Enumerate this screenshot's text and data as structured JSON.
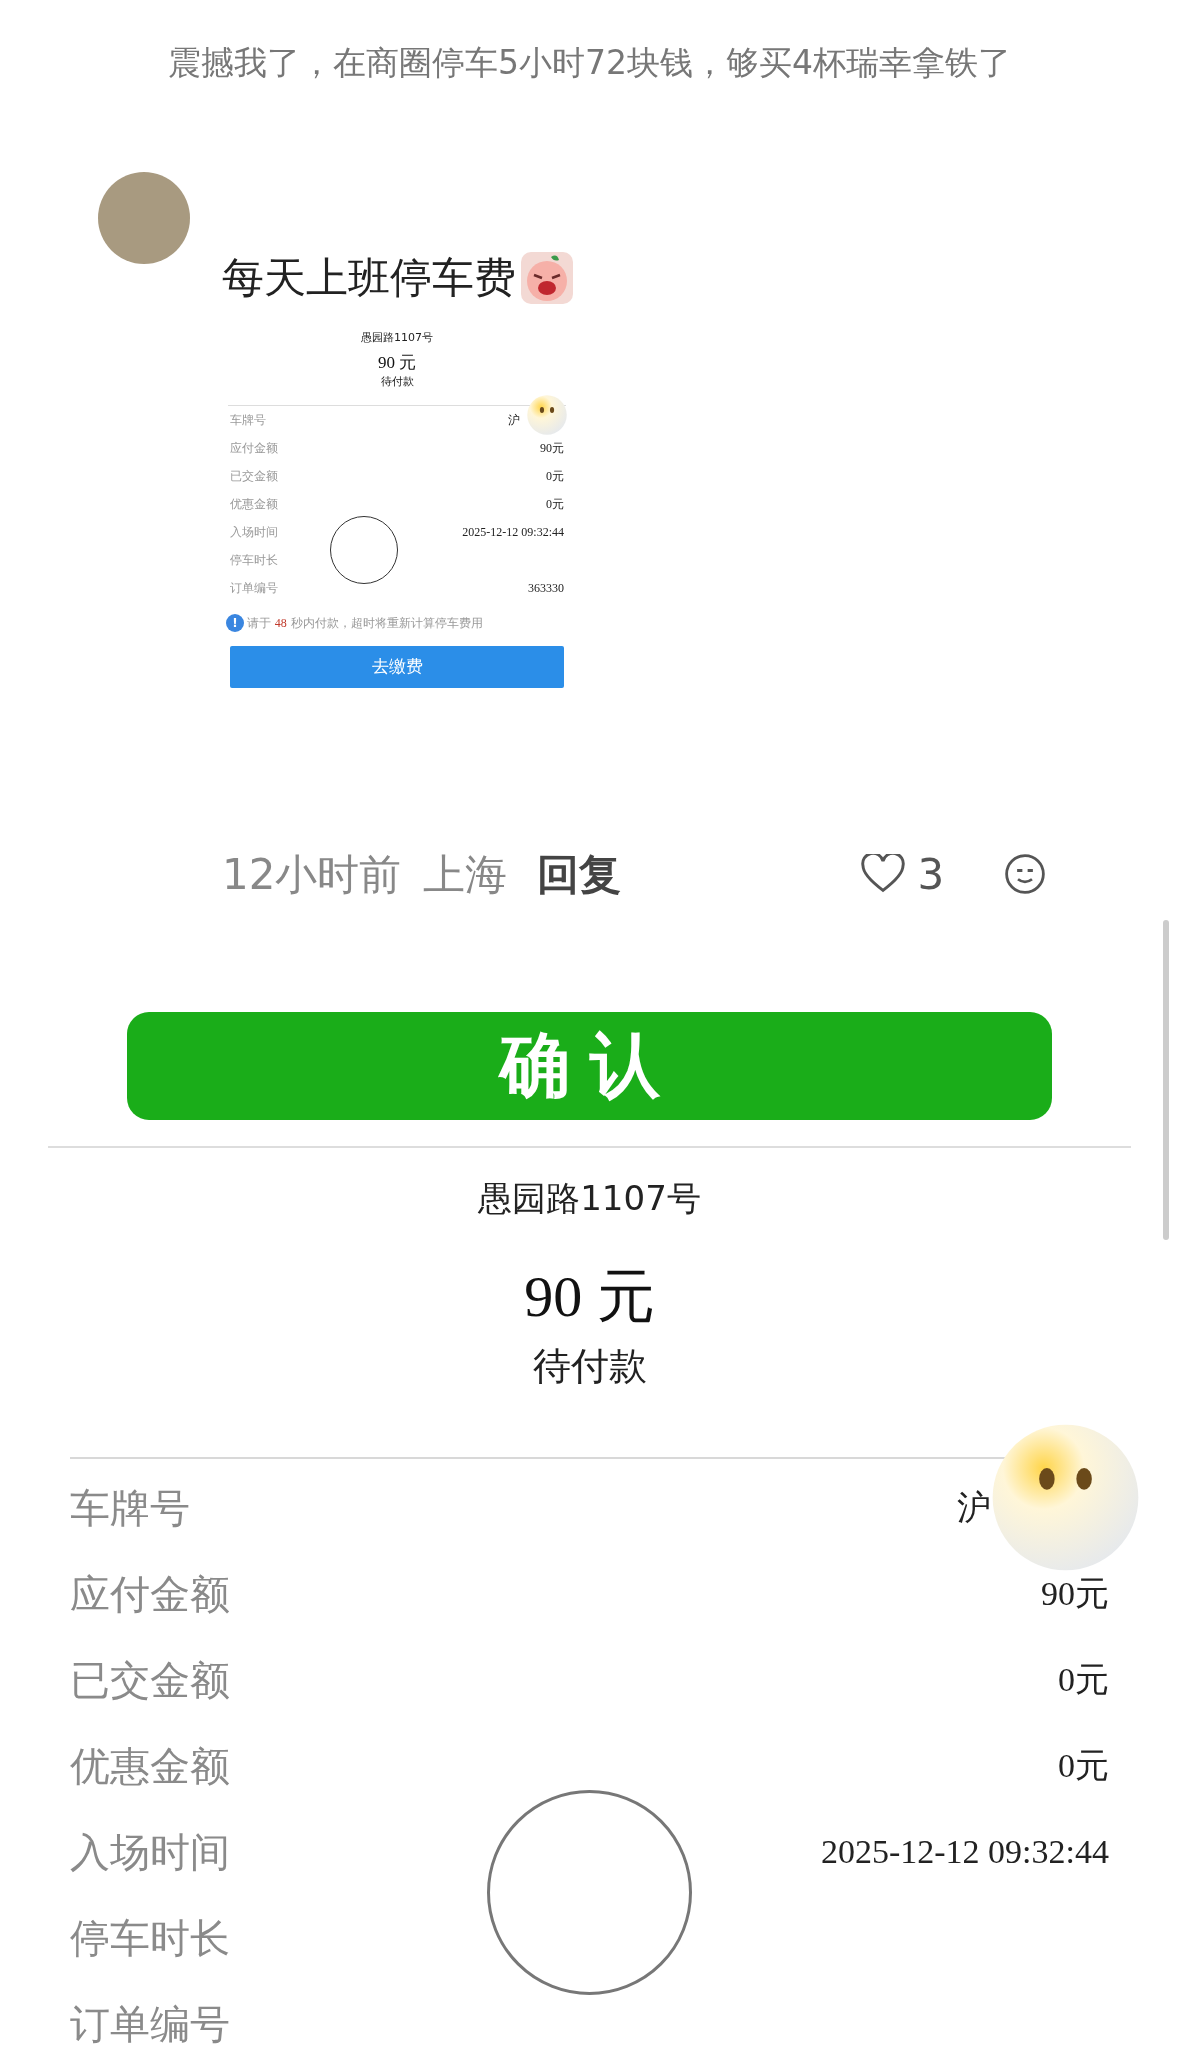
{
  "caption": "震撼我了，在商圈停车5小时72块钱，够买4杯瑞幸拿铁了",
  "comment": {
    "text": "每天上班停车费",
    "attachment": {
      "address": "愚园路1107号",
      "amount": "90 元",
      "status": "待付款",
      "rows": [
        {
          "label": "车牌号",
          "value": "沪"
        },
        {
          "label": "应付金额",
          "value": "90元"
        },
        {
          "label": "已交金额",
          "value": "0元"
        },
        {
          "label": "优惠金额",
          "value": "0元"
        },
        {
          "label": "入场时间",
          "value": "2025-12-12 09:32:44"
        },
        {
          "label": "停车时长"
        },
        {
          "label": "订单编号",
          "value": "363330"
        }
      ],
      "notice": {
        "icon": "!",
        "before": "请于",
        "count": "48",
        "after": "秒内付款，超时将重新计算停车费用"
      },
      "button": "去缴费"
    },
    "time": "12小时前",
    "location": "上海",
    "reply": "回复",
    "likes": "3"
  },
  "confirm_button": "确认",
  "receipt": {
    "address": "愚园路1107号",
    "amount": "90 元",
    "status": "待付款",
    "rows": [
      {
        "label": "车牌号",
        "value": "沪"
      },
      {
        "label": "应付金额",
        "value": "90元"
      },
      {
        "label": "已交金额",
        "value": "0元"
      },
      {
        "label": "优惠金额",
        "value": "0元"
      },
      {
        "label": "入场时间",
        "value": "2025-12-12 09:32:44"
      },
      {
        "label": "停车时长"
      },
      {
        "label": "订单编号"
      }
    ]
  }
}
